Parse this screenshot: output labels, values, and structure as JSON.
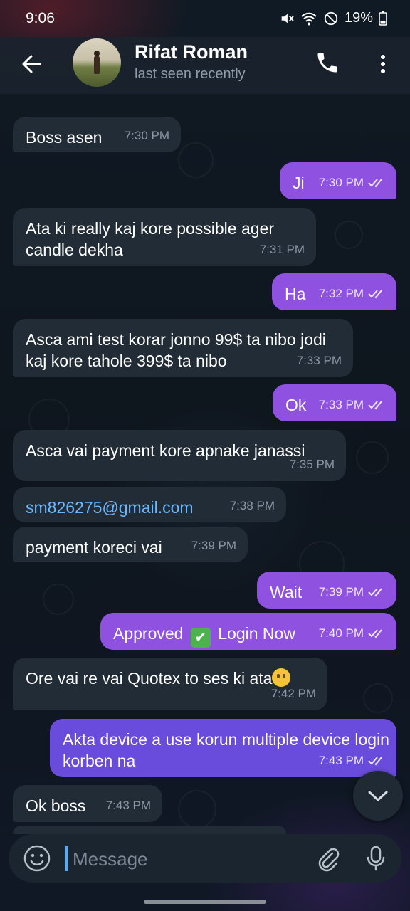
{
  "status_bar": {
    "time": "9:06",
    "battery": "19%"
  },
  "header": {
    "name": "Rifat Roman",
    "status": "last seen recently"
  },
  "messages": [
    {
      "dir": "in",
      "text": "Boss asen",
      "time": "7:30 PM"
    },
    {
      "dir": "out",
      "text": "Ji",
      "time": "7:30 PM"
    },
    {
      "dir": "in",
      "text": "Ata ki really kaj kore possible ager candle dekha",
      "time": "7:31 PM"
    },
    {
      "dir": "out",
      "text": "Ha",
      "time": "7:32 PM"
    },
    {
      "dir": "in",
      "text": "Asca ami test korar jonno 99$ ta nibo jodi kaj kore tahole 399$ ta nibo",
      "time": "7:33 PM"
    },
    {
      "dir": "out",
      "text": "Ok",
      "time": "7:33 PM"
    },
    {
      "dir": "in",
      "text": "Asca vai payment kore apnake janassi",
      "time": "7:35 PM"
    },
    {
      "dir": "in",
      "text": "sm826275@gmail.com",
      "time": "7:38 PM"
    },
    {
      "dir": "in",
      "text": "payment koreci vai",
      "time": "7:39 PM"
    },
    {
      "dir": "out",
      "text": "Wait",
      "time": "7:39 PM"
    },
    {
      "dir": "out",
      "text_before": "Approved",
      "text_after": "Login Now",
      "emoji": "✔",
      "time": "7:40 PM"
    },
    {
      "dir": "in",
      "text": "Ore vai re vai Quotex to ses ki ata",
      "time": "7:42 PM"
    },
    {
      "dir": "out",
      "text": "Akta device a use korun multiple device login korben na",
      "time": "7:43 PM"
    },
    {
      "dir": "in",
      "text": "Ok boss",
      "time": "7:43 PM"
    }
  ],
  "composer": {
    "placeholder": "Message"
  },
  "colors": {
    "outgoing": "#8f52e0",
    "outgoing_latest": "#6a4cdc",
    "incoming": "#212c37",
    "link": "#6ab8ff"
  }
}
